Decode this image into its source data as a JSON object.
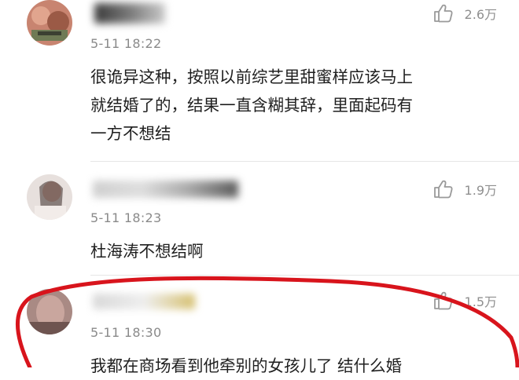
{
  "comments": [
    {
      "time": "5-11 18:22",
      "likes": "2.6万",
      "lines": [
        "很诡异这种，按照以前综艺里甜蜜样应该马上",
        "就结婚了的，结果一直含糊其辞，里面起码有",
        "一方不想结"
      ]
    },
    {
      "time": "5-11 18:23",
      "likes": "1.9万",
      "lines": [
        "杜海涛不想结啊"
      ]
    },
    {
      "time": "5-11 18:30",
      "likes": "1.5万",
      "lines": [
        "我都在商场看到他牵别的女孩儿了 结什么婚"
      ]
    }
  ],
  "icons": {
    "like": "thumbs-up-icon"
  },
  "colors": {
    "annotation": "#d8141c",
    "meta_gray": "#8a8a8a"
  }
}
